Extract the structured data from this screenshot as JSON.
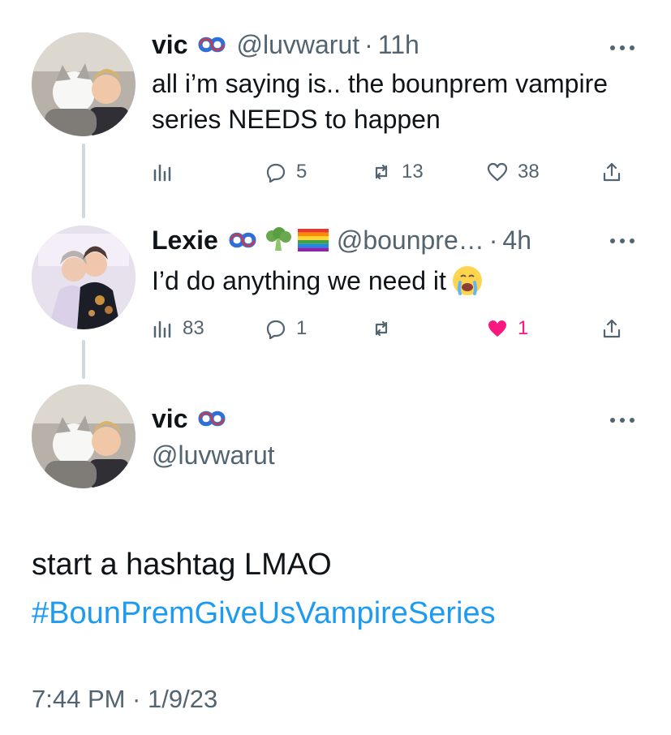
{
  "thread": [
    {
      "author": {
        "name": "vic",
        "handle": "@luvwarut",
        "time": "11h"
      },
      "text": "all i’m saying is.. the bounprem vampire series NEEDS to happen",
      "actions": {
        "views": "",
        "replies": "5",
        "retweets": "13",
        "likes": "38"
      },
      "icons": [
        "knot-emoji",
        "more-icon",
        "views-icon",
        "reply-icon",
        "retweet-icon",
        "heart-icon",
        "share-icon"
      ]
    },
    {
      "author": {
        "name": "Lexie",
        "handle": "@bounpre…",
        "time": "4h"
      },
      "text": "I’d do anything we need it",
      "actions": {
        "views": "83",
        "replies": "1",
        "retweets": "",
        "likes": "1"
      },
      "icons": [
        "knot-emoji",
        "broccoli-emoji",
        "rainbow-flag-emoji",
        "crying-emoji",
        "more-icon",
        "views-icon",
        "reply-icon",
        "retweet-icon",
        "heart-filled-icon",
        "share-icon"
      ]
    }
  ],
  "detail": {
    "name": "vic",
    "handle": "@luvwarut",
    "text_line1": "start a hashtag LMAO",
    "hashtag": "#BounPremGiveUsVampireSeries",
    "timestamp": "7:44 PM · 1/9/23",
    "icons": [
      "knot-emoji",
      "more-icon"
    ]
  },
  "colors": {
    "text": "#0f1419",
    "secondary": "#536471",
    "accent": "#1d9bf0",
    "like": "#f91880",
    "thread_line": "#cfd9de"
  }
}
